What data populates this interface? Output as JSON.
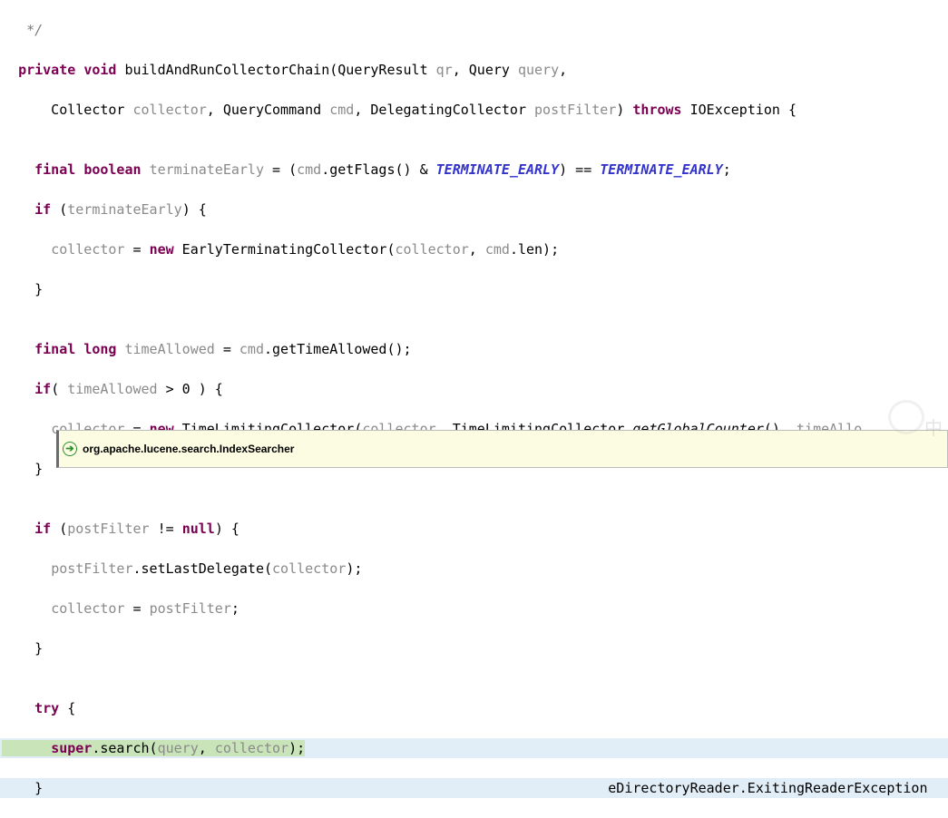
{
  "code": {
    "l00": "   */",
    "l01a": "  ",
    "l01_kw1": "private",
    "l01_sp1": " ",
    "l01_kw2": "void",
    "l01_sp2": " ",
    "l01_name": "buildAndRunCollectorChain",
    "l01_open": "(QueryResult ",
    "l01_p1": "qr",
    "l01_c1": ", Query ",
    "l01_p2": "query",
    "l01_end": ",",
    "l02a": "      Collector ",
    "l02_p1": "collector",
    "l02_c1": ", QueryCommand ",
    "l02_p2": "cmd",
    "l02_c2": ", DelegatingCollector ",
    "l02_p3": "postFilter",
    "l02_close": ") ",
    "l02_kw": "throws",
    "l02_sp": " IOException {",
    "l03": "",
    "l04_ind": "    ",
    "l04_kw1": "final",
    "l04_sp1": " ",
    "l04_kw2": "boolean",
    "l04_sp2": " ",
    "l04_var": "terminateEarly",
    "l04_eq": " = (",
    "l04_cmd": "cmd",
    "l04_dot": ".getFlags() & ",
    "l04_c1": "TERMINATE_EARLY",
    "l04_mid": ") == ",
    "l04_c2": "TERMINATE_EARLY",
    "l04_end": ";",
    "l05_ind": "    ",
    "l05_kw": "if",
    "l05_open": " (",
    "l05_var": "terminateEarly",
    "l05_close": ") {",
    "l06_ind": "      ",
    "l06_var": "collector",
    "l06_eq": " = ",
    "l06_kw": "new",
    "l06_sp": " EarlyTerminatingCollector(",
    "l06_p1": "collector",
    "l06_c1": ", ",
    "l06_p2": "cmd",
    "l06_dot": ".len);",
    "l07": "    }",
    "l08": "",
    "l09_ind": "    ",
    "l09_kw1": "final",
    "l09_sp1": " ",
    "l09_kw2": "long",
    "l09_sp2": " ",
    "l09_var": "timeAllowed",
    "l09_eq": " = ",
    "l09_cmd": "cmd",
    "l09_dot": ".getTimeAllowed();",
    "l10_ind": "    ",
    "l10_kw": "if",
    "l10_open": "( ",
    "l10_var": "timeAllowed",
    "l10_rest": " > 0 ) {",
    "l11_ind": "      ",
    "l11_var": "collector",
    "l11_eq": " = ",
    "l11_kw": "new",
    "l11_sp": " TimeLimitingCollector(",
    "l11_p1": "collector",
    "l11_c1": ", TimeLimitingCollector.",
    "l11_call": "getGlobalCounter",
    "l11_c2": "(), ",
    "l11_p2": "timeAllo",
    "l12": "    }",
    "l13": "",
    "l14_ind": "    ",
    "l14_kw": "if",
    "l14_open": " (",
    "l14_var": "postFilter",
    "l14_rest": " != ",
    "l14_kw2": "null",
    "l14_close": ") {",
    "l15_ind": "      ",
    "l15_var": "postFilter",
    "l15_dot": ".setLastDelegate(",
    "l15_p1": "collector",
    "l15_end": ");",
    "l16_ind": "      ",
    "l16_var": "collector",
    "l16_eq": " = ",
    "l16_p1": "postFilter",
    "l16_end": ";",
    "l17": "    }",
    "l18": "",
    "l19_ind": "    ",
    "l19_kw": "try",
    "l19_rest": " {",
    "l20_pre": "      ",
    "l20_kw": "super",
    "l20_dot": ".search(",
    "l20_p1": "query",
    "l20_c1": ", ",
    "l20_p2": "collector",
    "l20_end": ");",
    "l21_pre": "    }                                                                     eDirectoryReader.ExitingReaderException"
  },
  "tooltip": {
    "icon_glyph": "➔",
    "text": "org.apache.lucene.search.IndexSearcher"
  },
  "watermark": "中"
}
